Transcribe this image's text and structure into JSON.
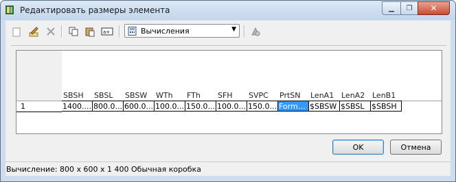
{
  "window": {
    "title": "Редактировать размеры элемента",
    "close_glyph": "✕",
    "min_glyph": "▁",
    "max_glyph": "❐"
  },
  "toolbar": {
    "icons": [
      "new-row-icon",
      "edit-icon",
      "delete-icon",
      "copy-icon",
      "paste-icon",
      "field-icon",
      "calculator-icon",
      "apply-icon"
    ],
    "combo_value": "Вычисления"
  },
  "grid": {
    "columns": [
      "SBSH",
      "SBSL",
      "SBSW",
      "WTh",
      "FTh",
      "SFH",
      "SVPC",
      "PrtSN",
      "LenA1",
      "LenA2",
      "LenB1"
    ],
    "rows": [
      {
        "num": "1",
        "cells": [
          "1400....",
          "800.0...",
          "600.0...",
          "100.0...",
          "150.0...",
          "100.0...",
          "150.0...",
          "Forma...",
          "$SBSW",
          "$SBSL",
          "$SBSH"
        ],
        "selected_index": 7
      }
    ]
  },
  "buttons": {
    "ok": "OK",
    "cancel": "Отмена"
  },
  "status": "Вычисление: 800 x 600 x 1 400 Обычная коробка",
  "colors": {
    "selection": "#3399ff",
    "titlebar": "#c3d6ec",
    "close": "#c84c32"
  }
}
